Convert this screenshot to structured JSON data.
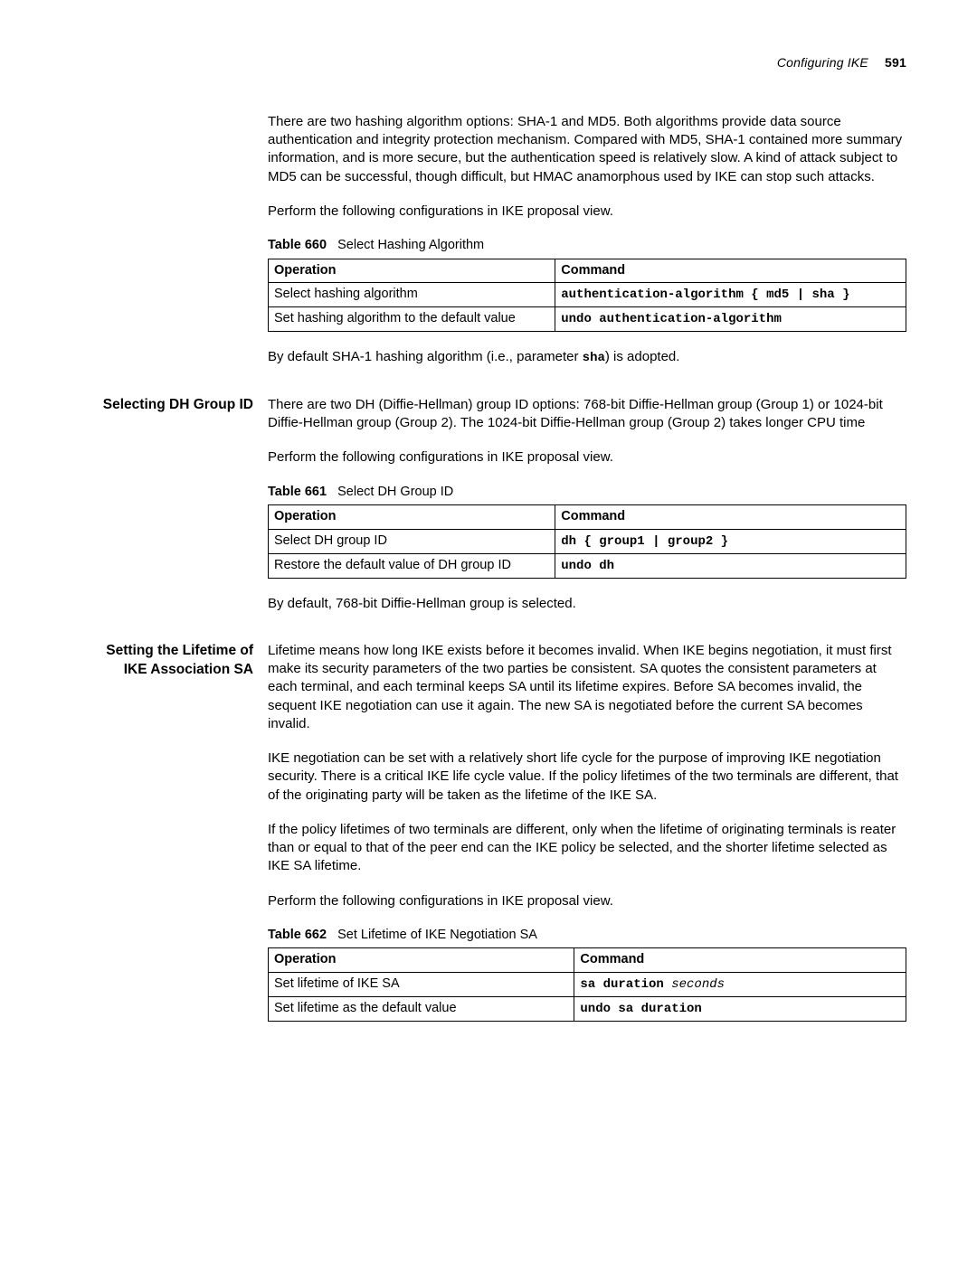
{
  "header": {
    "section": "Configuring IKE",
    "page_number": "591"
  },
  "section1": {
    "heading": "",
    "p1": "There are two hashing algorithm options: SHA-1 and MD5. Both algorithms provide data source authentication and integrity protection mechanism. Compared with MD5, SHA-1 contained more summary information, and is more secure, but the authentication speed is relatively slow. A kind of attack subject to MD5 can be successful, though difficult, but HMAC anamorphous used by IKE can stop such attacks.",
    "p2": "Perform  the following configurations in IKE proposal view.",
    "table": {
      "label": "Table 660",
      "title": "Select Hashing Algorithm",
      "col1": "Operation",
      "col2": "Command",
      "rows": [
        {
          "op": "Select hashing algorithm",
          "cmd": "authentication-algorithm { md5 | sha }"
        },
        {
          "op": "Set hashing algorithm to the default value",
          "cmd": "undo authentication-algorithm"
        }
      ]
    },
    "p3_pre": "By default SHA-1 hashing algorithm (i.e., parameter ",
    "p3_code": "sha",
    "p3_post": ") is adopted."
  },
  "section2": {
    "heading": "Selecting DH Group ID",
    "p1": "There are two DH (Diffie-Hellman) group ID options: 768-bit Diffie-Hellman group (Group 1) or 1024-bit Diffie-Hellman group (Group 2). The 1024-bit Diffie-Hellman group (Group 2) takes longer CPU time",
    "p2": "Perform  the following configurations in IKE proposal view.",
    "table": {
      "label": "Table 661",
      "title": "Select DH Group ID",
      "col1": "Operation",
      "col2": "Command",
      "rows": [
        {
          "op": "Select DH group ID",
          "cmd": "dh { group1 | group2 }"
        },
        {
          "op": "Restore the default value of DH group ID",
          "cmd": "undo dh"
        }
      ]
    },
    "p3": "By default, 768-bit Diffie-Hellman group is selected."
  },
  "section3": {
    "heading_l1": "Setting the Lifetime of",
    "heading_l2": "IKE Association SA",
    "p1": "Lifetime means how long IKE exists before it becomes invalid. When IKE begins negotiation, it must first make its security parameters of the two parties be consistent. SA quotes the consistent parameters at each terminal, and each terminal keeps SA until its lifetime expires. Before SA becomes invalid, the sequent IKE negotiation can use it again. The new SA is negotiated before the current SA becomes invalid.",
    "p2": "IKE negotiation can be set with a relatively short life cycle for the purpose of improving IKE negotiation security. There is a critical IKE life cycle value. If the policy lifetimes of the two terminals are different, that of the originating party will be taken as the lifetime of the IKE SA.",
    "p3": "If the policy lifetimes of two terminals are different, only when the lifetime of originating terminals is reater than or equal to that of the peer end can the IKE policy be selected, and the shorter lifetime selected as IKE SA lifetime.",
    "p4": "Perform the following configurations in IKE proposal view.",
    "table": {
      "label": "Table 662",
      "title": "Set Lifetime of IKE Negotiation SA",
      "col1": "Operation",
      "col2": "Command",
      "rows": [
        {
          "op": "Set lifetime of IKE SA",
          "cmd_pre": "sa duration ",
          "cmd_ital": "seconds"
        },
        {
          "op": "Set lifetime as the default value",
          "cmd": "undo sa duration"
        }
      ]
    }
  }
}
